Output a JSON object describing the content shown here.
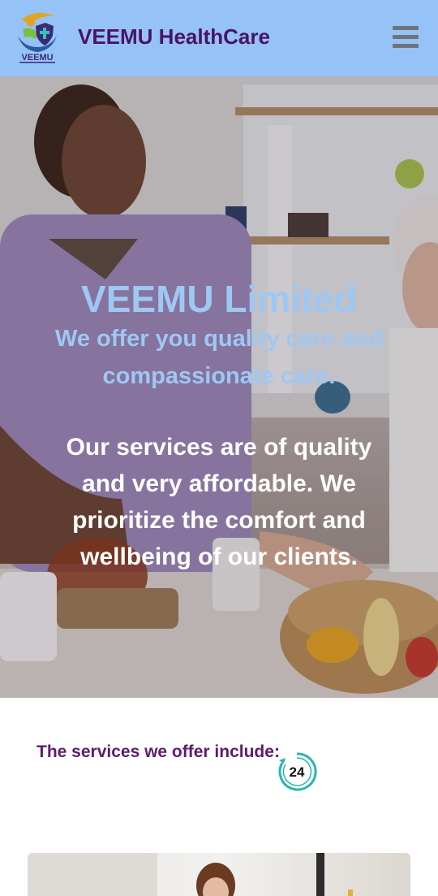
{
  "header": {
    "logo_text": "VEEMU",
    "brand": "VEEMU HealthCare"
  },
  "hero": {
    "title": "VEEMU Limited",
    "subtitle": "We offer you quality care and compassionate care.",
    "body": "Our services are of quality and very affordable. We prioritize the comfort and wellbeing of our clients."
  },
  "services": {
    "heading": "The services we offer include:",
    "badge": "24"
  },
  "colors": {
    "header_bg": "#96c3f7",
    "brand_purple": "#4a1464",
    "accent_blue": "#9ec8f4",
    "teal": "#2bb5b0"
  }
}
